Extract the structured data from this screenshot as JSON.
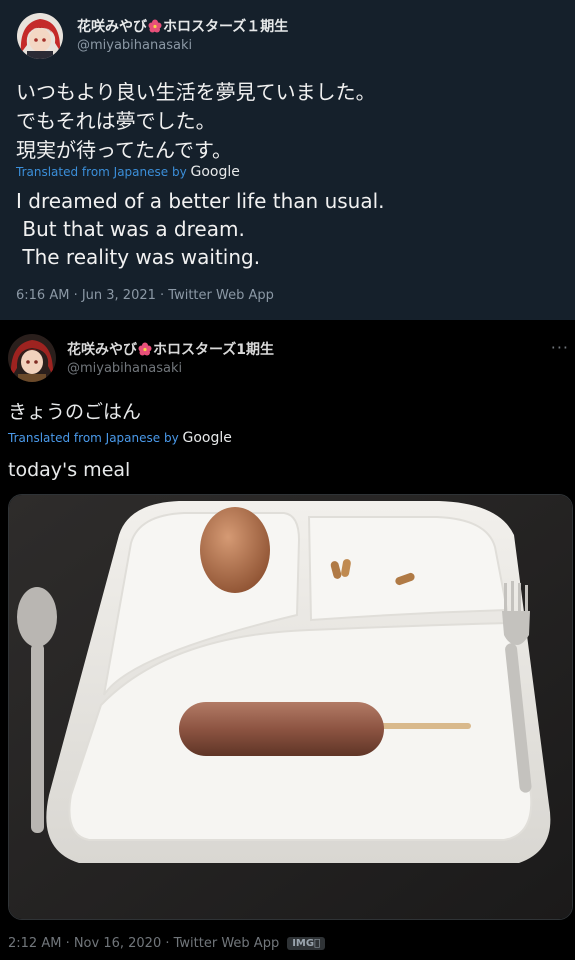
{
  "tweet_top": {
    "display_name_prefix": "花咲みやび",
    "display_name_suffix": "ホロスターズ１期生",
    "handle": "@miyabihanasaki",
    "text_ja": "いつもより良い生活を夢見ていました。\nでもそれは夢でした。\n現実が待ってたんです。",
    "translated_from": "Translated from Japanese by",
    "google": "Google",
    "text_en": "I dreamed of a better life than usual.\n But that was a dream.\n The reality was waiting.",
    "meta": "6:16 AM · Jun 3, 2021 · Twitter Web App"
  },
  "tweet_bottom": {
    "display_name_prefix": "花咲みやび",
    "display_name_suffix": "ホロスターズ1期生",
    "handle": "@miyabihanasaki",
    "more": "···",
    "text_ja": "きょうのごはん",
    "translated_from": "Translated from Japanese by",
    "google": "Google",
    "text_en": "today's meal",
    "meta": "2:12 AM · Nov 16, 2020 · Twitter Web App",
    "img_badge": "IMG⃝"
  },
  "icons": {
    "flower": "hibiscus-flower-icon",
    "more": "more-dots-icon"
  },
  "colors": {
    "top_bg": "#15202b",
    "bottom_bg": "#000000",
    "link_blue": "#4a99e9"
  }
}
